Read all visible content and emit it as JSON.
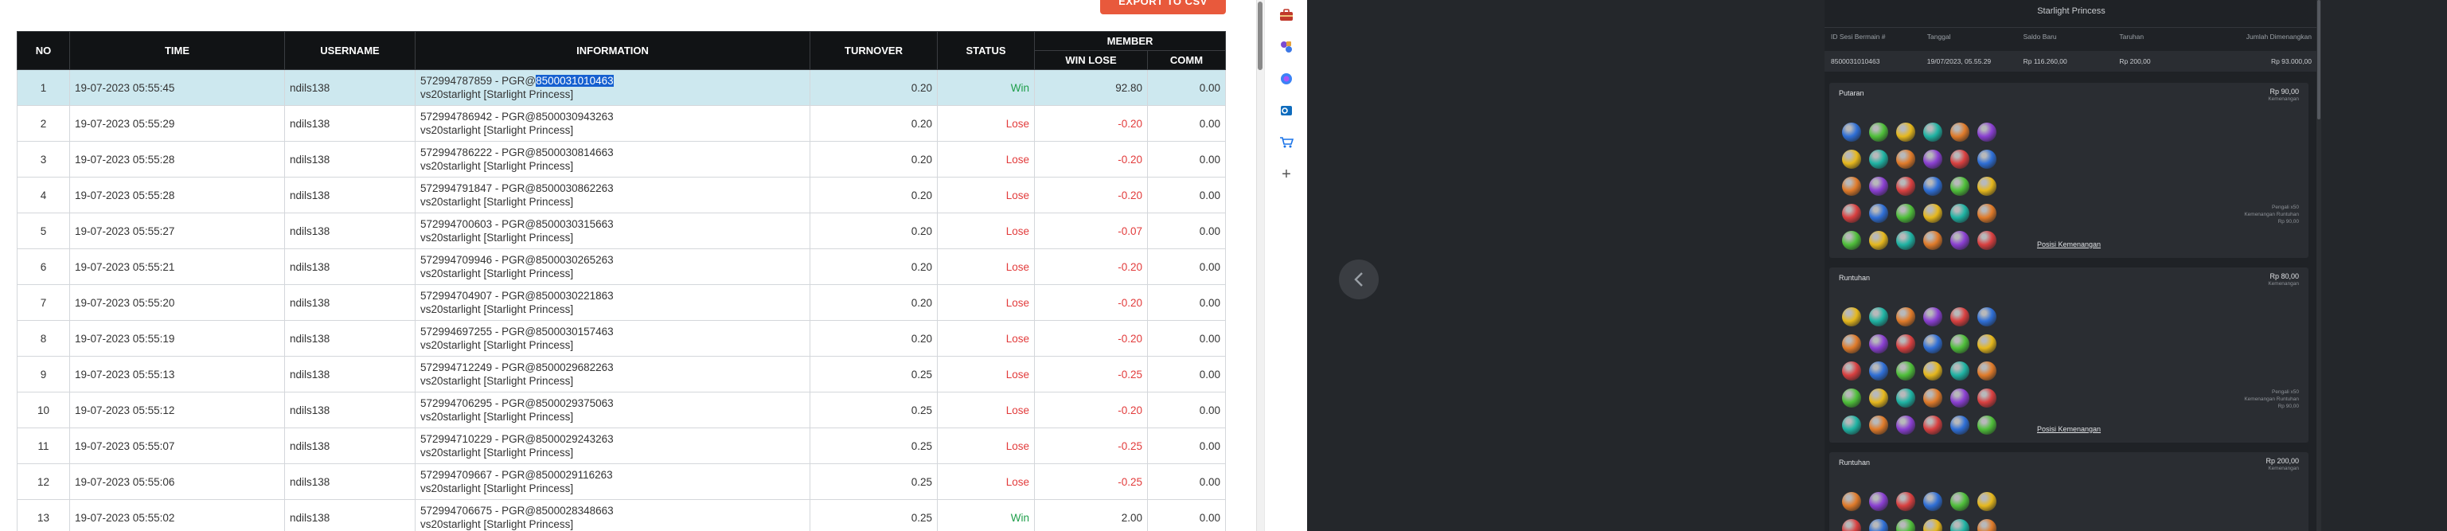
{
  "toolbar": {
    "export_label": "EXPORT TO CSV"
  },
  "table": {
    "headers": {
      "no": "NO",
      "time": "TIME",
      "username": "USERNAME",
      "information": "INFORMATION",
      "turnover": "TURNOVER",
      "status": "STATUS",
      "member": "MEMBER",
      "win_lose": "WIN LOSE",
      "comm": "COMM"
    },
    "rows": [
      {
        "no": "1",
        "time": "19-07-2023 05:55:45",
        "user": "ndils138",
        "ref_pre": "572994787859 - PGR@",
        "ref_hl": "8500031010463",
        "game": "vs20starlight [Starlight Princess]",
        "turnover": "0.20",
        "status": "Win",
        "winlose": "92.80",
        "comm": "0.00"
      },
      {
        "no": "2",
        "time": "19-07-2023 05:55:29",
        "user": "ndils138",
        "ref_pre": "572994786942 - PGR@8500030943263",
        "ref_hl": "",
        "game": "vs20starlight [Starlight Princess]",
        "turnover": "0.20",
        "status": "Lose",
        "winlose": "-0.20",
        "comm": "0.00"
      },
      {
        "no": "3",
        "time": "19-07-2023 05:55:28",
        "user": "ndils138",
        "ref_pre": "572994786222 - PGR@8500030814663",
        "ref_hl": "",
        "game": "vs20starlight [Starlight Princess]",
        "turnover": "0.20",
        "status": "Lose",
        "winlose": "-0.20",
        "comm": "0.00"
      },
      {
        "no": "4",
        "time": "19-07-2023 05:55:28",
        "user": "ndils138",
        "ref_pre": "572994791847 - PGR@8500030862263",
        "ref_hl": "",
        "game": "vs20starlight [Starlight Princess]",
        "turnover": "0.20",
        "status": "Lose",
        "winlose": "-0.20",
        "comm": "0.00"
      },
      {
        "no": "5",
        "time": "19-07-2023 05:55:27",
        "user": "ndils138",
        "ref_pre": "572994700603 - PGR@8500030315663",
        "ref_hl": "",
        "game": "vs20starlight [Starlight Princess]",
        "turnover": "0.20",
        "status": "Lose",
        "winlose": "-0.07",
        "comm": "0.00"
      },
      {
        "no": "6",
        "time": "19-07-2023 05:55:21",
        "user": "ndils138",
        "ref_pre": "572994709946 - PGR@8500030265263",
        "ref_hl": "",
        "game": "vs20starlight [Starlight Princess]",
        "turnover": "0.20",
        "status": "Lose",
        "winlose": "-0.20",
        "comm": "0.00"
      },
      {
        "no": "7",
        "time": "19-07-2023 05:55:20",
        "user": "ndils138",
        "ref_pre": "572994704907 - PGR@8500030221863",
        "ref_hl": "",
        "game": "vs20starlight [Starlight Princess]",
        "turnover": "0.20",
        "status": "Lose",
        "winlose": "-0.20",
        "comm": "0.00"
      },
      {
        "no": "8",
        "time": "19-07-2023 05:55:19",
        "user": "ndils138",
        "ref_pre": "572994697255 - PGR@8500030157463",
        "ref_hl": "",
        "game": "vs20starlight [Starlight Princess]",
        "turnover": "0.20",
        "status": "Lose",
        "winlose": "-0.20",
        "comm": "0.00"
      },
      {
        "no": "9",
        "time": "19-07-2023 05:55:13",
        "user": "ndils138",
        "ref_pre": "572994712249 - PGR@8500029682263",
        "ref_hl": "",
        "game": "vs20starlight [Starlight Princess]",
        "turnover": "0.25",
        "status": "Lose",
        "winlose": "-0.25",
        "comm": "0.00"
      },
      {
        "no": "10",
        "time": "19-07-2023 05:55:12",
        "user": "ndils138",
        "ref_pre": "572994706295 - PGR@8500029375063",
        "ref_hl": "",
        "game": "vs20starlight [Starlight Princess]",
        "turnover": "0.25",
        "status": "Lose",
        "winlose": "-0.20",
        "comm": "0.00"
      },
      {
        "no": "11",
        "time": "19-07-2023 05:55:07",
        "user": "ndils138",
        "ref_pre": "572994710229 - PGR@8500029243263",
        "ref_hl": "",
        "game": "vs20starlight [Starlight Princess]",
        "turnover": "0.25",
        "status": "Lose",
        "winlose": "-0.25",
        "comm": "0.00"
      },
      {
        "no": "12",
        "time": "19-07-2023 05:55:06",
        "user": "ndils138",
        "ref_pre": "572994709667 - PGR@8500029116263",
        "ref_hl": "",
        "game": "vs20starlight [Starlight Princess]",
        "turnover": "0.25",
        "status": "Lose",
        "winlose": "-0.25",
        "comm": "0.00"
      },
      {
        "no": "13",
        "time": "19-07-2023 05:55:02",
        "user": "ndils138",
        "ref_pre": "572994706675 - PGR@8500028348663",
        "ref_hl": "",
        "game": "vs20starlight [Starlight Princess]",
        "turnover": "0.25",
        "status": "Win",
        "winlose": "2.00",
        "comm": "0.00"
      }
    ]
  },
  "sidebar": {
    "icons": [
      "briefcase-icon",
      "puzzle-icon",
      "copilot-icon",
      "outlook-icon",
      "shopping-cart-icon",
      "plus-icon"
    ]
  },
  "game_panel": {
    "title": "Starlight Princess",
    "summary_headers": [
      "ID Sesi Bermain #",
      "Tanggal",
      "Saldo Baru",
      "Taruhan",
      "Jumlah Dimenangkan"
    ],
    "summary_row": [
      "8500031010463",
      "19/07/2023, 05.55.29",
      "Rp 116.260,00",
      "Rp 200,00",
      "Rp 93.000,00"
    ],
    "cards": [
      {
        "title": "Putaran",
        "amount": "Rp 90,00",
        "sub": "Kemenangan",
        "info": [
          "Pengali x50",
          "Kemenangan Runtuhan",
          "Rp 90,00"
        ],
        "link": "Posisi Kemenangan"
      },
      {
        "title": "Runtuhan",
        "amount": "Rp 80,00",
        "sub": "Kemenangan",
        "info": [
          "Pengali x50",
          "Kemenangan Runtuhan",
          "Rp 90,00"
        ],
        "link": "Posisi Kemenangan"
      },
      {
        "title": "Runtuhan",
        "amount": "Rp 200,00",
        "sub": "Kemenangan",
        "info": [],
        "link": ""
      }
    ],
    "gem_colors": [
      "#2f6fd6",
      "#1fb3a3",
      "#d94040",
      "#e6b81d",
      "#8a3fd1",
      "#4fbf3a",
      "#e07b2a"
    ]
  }
}
